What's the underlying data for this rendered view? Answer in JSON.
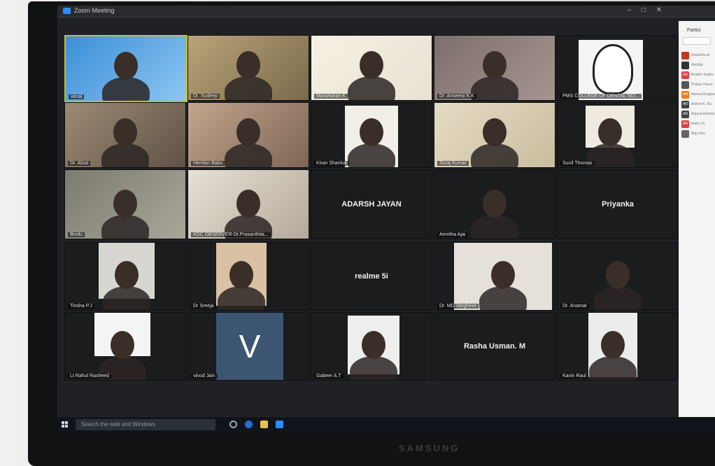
{
  "window": {
    "title": "Zoom Meeting"
  },
  "tiles": [
    {
      "id": "r1c1",
      "name": "vimal",
      "active": true,
      "big": ""
    },
    {
      "id": "r1c2",
      "name": "Dr. Sudeep",
      "big": ""
    },
    {
      "id": "r1c3",
      "name": "Manoharan K",
      "big": ""
    },
    {
      "id": "r1c4",
      "name": "Dr. Anseera K.K",
      "big": ""
    },
    {
      "id": "r1c5",
      "name": "PMS COLLEGE OF DENTAL SCI...",
      "big": ""
    },
    {
      "id": "r2c1",
      "name": "Dr. Afzal",
      "big": ""
    },
    {
      "id": "r2c2",
      "name": "Hemlan Babu",
      "big": ""
    },
    {
      "id": "r2c3",
      "name": "Kiran Shankar",
      "big": ""
    },
    {
      "id": "r2c4",
      "name": "Suraj Kumar",
      "big": ""
    },
    {
      "id": "r2c5",
      "name": "Sunil Thomas",
      "big": ""
    },
    {
      "id": "r3c1",
      "name": "Bindu",
      "big": ""
    },
    {
      "id": "r3c2",
      "name": "KDC OBSERVER-Dr.Prasanthila...",
      "big": ""
    },
    {
      "id": "r3c3",
      "name": "",
      "big": "ADARSH JAYAN"
    },
    {
      "id": "r3c4",
      "name": "Amritha Ajai",
      "big": ""
    },
    {
      "id": "r3c5",
      "name": "",
      "big": "Priyanka"
    },
    {
      "id": "r4c1",
      "name": "Tinsha P.J",
      "big": ""
    },
    {
      "id": "r4c2",
      "name": "Dr Sreeja",
      "big": ""
    },
    {
      "id": "r4c3",
      "name": "",
      "big": "realme 5i"
    },
    {
      "id": "r4c4",
      "name": "Dr. MD Varghese",
      "big": ""
    },
    {
      "id": "r4c5",
      "name": "Dr. Anamar",
      "big": ""
    },
    {
      "id": "r5c1",
      "name": "Lt Rahul Rasheed",
      "big": ""
    },
    {
      "id": "r5c2",
      "name": "vinod Jain",
      "big": "V"
    },
    {
      "id": "r5c3",
      "name": "Gabeer A.T",
      "big": ""
    },
    {
      "id": "r5c4",
      "name": "",
      "big": "Rasha Usman. M"
    },
    {
      "id": "r5c5",
      "name": "Kavin Raul",
      "big": ""
    }
  ],
  "participants_panel": {
    "header": "Partici",
    "items": [
      {
        "initials": "",
        "color": "#c0392b",
        "label": "Ameetha sti"
      },
      {
        "initials": "",
        "color": "#333333",
        "label": "Abdulla"
      },
      {
        "initials": "AS",
        "color": "#d64545",
        "label": "Aradhe Sudhe"
      },
      {
        "initials": "",
        "color": "#555555",
        "label": "Prakas Haree"
      },
      {
        "initials": "AM",
        "color": "#e67e22",
        "label": "Aleena Anagha"
      },
      {
        "initials": "AR",
        "color": "#444444",
        "label": "Aniline K. Ra"
      },
      {
        "initials": "AR",
        "color": "#444444",
        "label": "Anjana Ashwat"
      },
      {
        "initials": "AR",
        "color": "#d64545",
        "label": "Anila J K"
      },
      {
        "initials": "",
        "color": "#666666",
        "label": "Anju Anu"
      }
    ]
  },
  "taskbar": {
    "search_placeholder": "Search the web and Windows"
  },
  "monitor": {
    "brand": "SAMSUNG"
  }
}
